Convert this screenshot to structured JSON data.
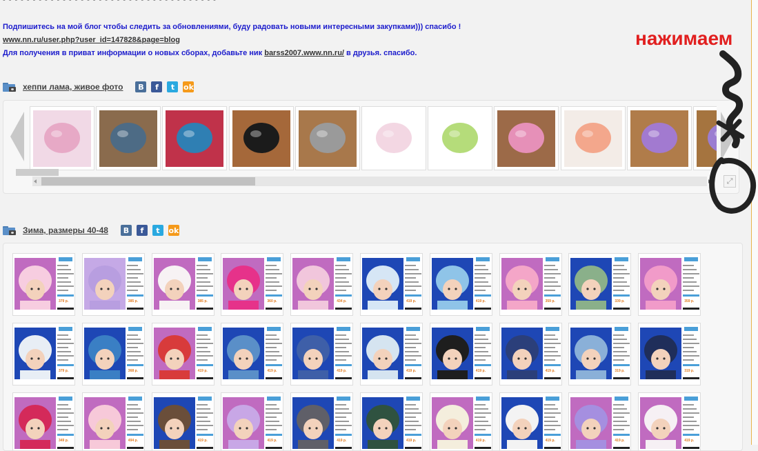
{
  "top_cut": "‐ ‐ ‐ ‐ ‐ ‐ ‐ ‐ ‐ ‐ ‐ ‐ ‐ ‐ ‐ ‐ ‐ ‐ ‐ ‐ ‐ ‐ ‐ ‐ ‐ ‐ ‐ ‐ ‐ ‐ ‐ ‐ ‐ ‐ ‐ ‐",
  "blog": {
    "note": "Подпишитесь на мой блог чтобы следить за обновлениями, буду радовать новыми интересными закупками))) спасибо !",
    "link": "www.nn.ru/user.php?user_id=147828&page=blog",
    "private_before": "Для получения в приват информации о новых сборах, добавьте ник ",
    "nick": "barss2007.www.nn.ru/",
    "private_after": " в друзья. спасибо."
  },
  "albums": [
    {
      "title": "хеппи лама, живое фото"
    },
    {
      "title": "Зима, размеры 40-48"
    }
  ],
  "social": {
    "vk": "В",
    "fb": "f",
    "tw": "t",
    "ok": "ok"
  },
  "annotation": {
    "text": "нажимаем",
    "color": "#e11f1f"
  },
  "colors": {
    "link_blue": "#1c1ccc",
    "accent_border": "#e8b44a"
  },
  "carousel": {
    "thumbs": [
      {
        "name": "pink-cat-hat",
        "bg": "#f1d9e6",
        "obj": "#e7a9c6"
      },
      {
        "name": "gray-mittens-set",
        "bg": "#8a6b4d",
        "obj": "#4d6b85"
      },
      {
        "name": "colorful-hats-set",
        "bg": "#c0324a",
        "obj": "#2f7fb3"
      },
      {
        "name": "black-mittens",
        "bg": "#a5683a",
        "obj": "#1b1b1b"
      },
      {
        "name": "gray-gloves",
        "bg": "#a8784b",
        "obj": "#9a9a9a"
      },
      {
        "name": "white-hat-pompom",
        "bg": "#ffffff",
        "obj": "#f3d7e3"
      },
      {
        "name": "green-hat",
        "bg": "#ffffff",
        "obj": "#b5dc7a"
      },
      {
        "name": "pink-mittens",
        "bg": "#9c6a48",
        "obj": "#e690b8"
      },
      {
        "name": "striped-hat",
        "bg": "#f3ece7",
        "obj": "#f3a78c"
      },
      {
        "name": "purple-mittens",
        "bg": "#b07c4a",
        "obj": "#a27ad0"
      },
      {
        "name": "partial-thumb",
        "bg": "#a5743f",
        "obj": "#9b7dd1"
      }
    ]
  },
  "grid": {
    "rows": [
      [
        {
          "bg": "#c06bc0",
          "hat": "#f7cde0",
          "price": "379 р."
        },
        {
          "bg": "#c5a9e6",
          "hat": "#b89ee0",
          "price": "385 р."
        },
        {
          "bg": "#c06bc0",
          "hat": "#f7f2f4",
          "price": "385 р."
        },
        {
          "bg": "#c06bc0",
          "hat": "#e6328a",
          "price": "360 р."
        },
        {
          "bg": "#c06bc0",
          "hat": "#f1c6dc",
          "price": "434 р."
        },
        {
          "bg": "#1e47b5",
          "hat": "#d6e6f5",
          "price": "419 р."
        },
        {
          "bg": "#1e47b5",
          "hat": "#8fc4e8",
          "price": "419 р."
        },
        {
          "bg": "#c06bc0",
          "hat": "#f4a6c8",
          "price": "359 р."
        },
        {
          "bg": "#1e47b5",
          "hat": "#8ab08a",
          "price": "339 р."
        },
        {
          "bg": "#c06bc0",
          "hat": "#f19bc9",
          "price": "359 р."
        }
      ],
      [
        {
          "bg": "#1e47b5",
          "hat": "#e8eef5",
          "price": "379 р."
        },
        {
          "bg": "#1e47b5",
          "hat": "#3a7fc4",
          "price": "368 р."
        },
        {
          "bg": "#c06bc0",
          "hat": "#d83b3b",
          "price": "419 р."
        },
        {
          "bg": "#1e47b5",
          "hat": "#5a8fc8",
          "price": "419 р."
        },
        {
          "bg": "#1e47b5",
          "hat": "#3e5fa8",
          "price": "419 р."
        },
        {
          "bg": "#1e47b5",
          "hat": "#d5e4f0",
          "price": "419 р."
        },
        {
          "bg": "#1e47b5",
          "hat": "#1e1e1e",
          "price": "419 р."
        },
        {
          "bg": "#1e47b5",
          "hat": "#2b3f7a",
          "price": "419 р."
        },
        {
          "bg": "#1e47b5",
          "hat": "#8ab0d8",
          "price": "319 р."
        },
        {
          "bg": "#1e47b5",
          "hat": "#1f2e5a",
          "price": "319 р."
        }
      ],
      [
        {
          "bg": "#c06bc0",
          "hat": "#d42a5a",
          "price": "349 р."
        },
        {
          "bg": "#c06bc0",
          "hat": "#f7c9d9",
          "price": "494 р."
        },
        {
          "bg": "#1e47b5",
          "hat": "#6a4e3a",
          "price": "419 р."
        },
        {
          "bg": "#c06bc0",
          "hat": "#c8a7e6",
          "price": "419 р."
        },
        {
          "bg": "#1e47b5",
          "hat": "#5f5f68",
          "price": "419 р."
        },
        {
          "bg": "#1e47b5",
          "hat": "#2f5240",
          "price": "419 р."
        },
        {
          "bg": "#c06bc0",
          "hat": "#f4eedd",
          "price": "419 р."
        },
        {
          "bg": "#1e47b5",
          "hat": "#f3f3f3",
          "price": "419 р."
        },
        {
          "bg": "#c06bc0",
          "hat": "#a58fe0",
          "price": "419 р."
        },
        {
          "bg": "#c06bc0",
          "hat": "#f6f0f4",
          "price": "419 р."
        }
      ]
    ]
  }
}
